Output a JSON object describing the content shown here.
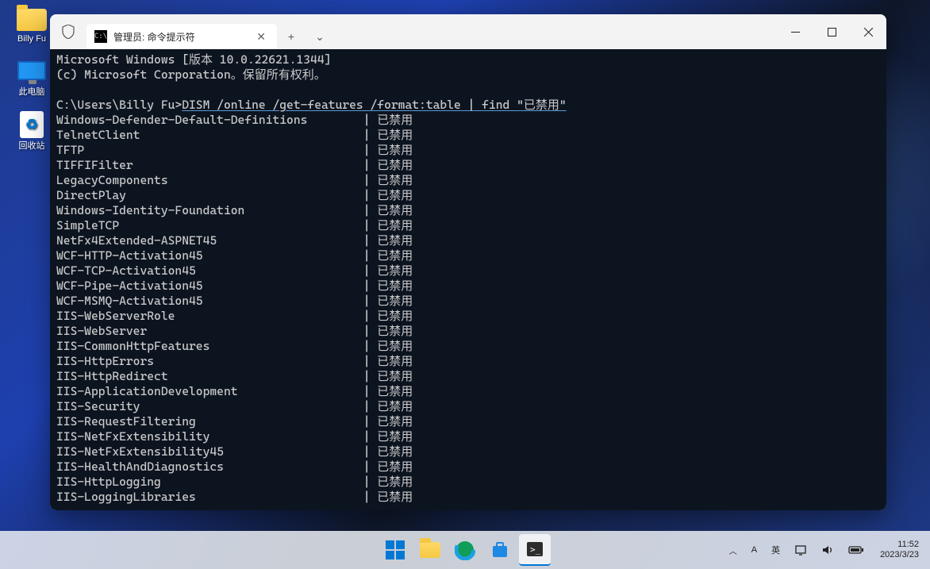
{
  "desktop": {
    "icons": [
      {
        "name": "folder-icon",
        "label": "Billy Fu"
      },
      {
        "name": "this-pc-icon",
        "label": "此电脑"
      },
      {
        "name": "recycle-bin-icon",
        "label": "回收站"
      }
    ]
  },
  "window": {
    "tab_title": "管理员: 命令提示符",
    "controls": {
      "min": "—",
      "max": "□",
      "close": "✕",
      "newtab": "+",
      "drop": "⌄",
      "tabclose": "✕"
    }
  },
  "terminal": {
    "header1": "Microsoft Windows [版本 10.0.22621.1344]",
    "header2": "(c) Microsoft Corporation。保留所有权利。",
    "prompt": "C:\\Users\\Billy Fu>",
    "command": "DISM /online /get-features /format:table | find \"已禁用\"",
    "status_text": "已禁用",
    "separator": "| ",
    "features": [
      "Windows-Defender-Default-Definitions",
      "TelnetClient",
      "TFTP",
      "TIFFIFilter",
      "LegacyComponents",
      "DirectPlay",
      "Windows-Identity-Foundation",
      "SimpleTCP",
      "NetFx4Extended-ASPNET45",
      "WCF-HTTP-Activation45",
      "WCF-TCP-Activation45",
      "WCF-Pipe-Activation45",
      "WCF-MSMQ-Activation45",
      "IIS-WebServerRole",
      "IIS-WebServer",
      "IIS-CommonHttpFeatures",
      "IIS-HttpErrors",
      "IIS-HttpRedirect",
      "IIS-ApplicationDevelopment",
      "IIS-Security",
      "IIS-RequestFiltering",
      "IIS-NetFxExtensibility",
      "IIS-NetFxExtensibility45",
      "IIS-HealthAndDiagnostics",
      "IIS-HttpLogging",
      "IIS-LoggingLibraries"
    ]
  },
  "taskbar": {
    "ime": "英",
    "lang_prefix": "A",
    "time": "11:52",
    "date": "2023/3/23"
  }
}
